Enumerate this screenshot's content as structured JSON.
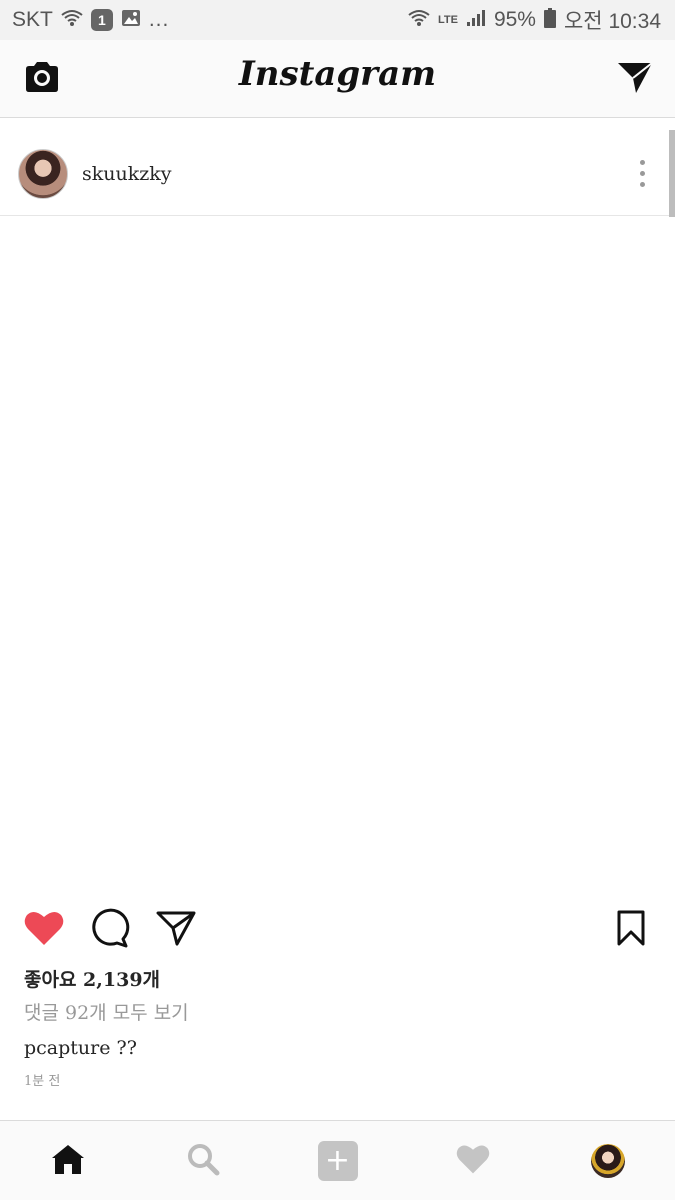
{
  "status_bar": {
    "carrier": "SKT",
    "notification_count": "1",
    "more": "...",
    "network": "LTE",
    "battery": "95%",
    "time": "오전 10:34"
  },
  "header": {
    "brand": "Instagram",
    "left_icon": "camera-icon",
    "right_icon": "direct-message-icon"
  },
  "post": {
    "username": "skuukzky",
    "likes": "좋아요 2,139개",
    "view_comments": "댓글 92개 모두 보기",
    "caption": "pcapture ??",
    "time_ago": "1분 전",
    "liked": true,
    "like_color": "#ed4956"
  },
  "bottom_nav": {
    "items": [
      "home-icon",
      "search-icon",
      "add-post-icon",
      "activity-heart-icon",
      "profile-avatar"
    ],
    "active": "home-icon"
  }
}
